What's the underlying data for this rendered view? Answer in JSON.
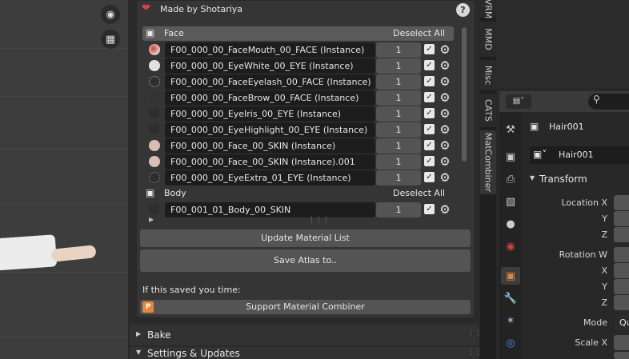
{
  "panel": {
    "made_by": "Made by Shotariya",
    "help": "?",
    "groups": [
      {
        "name": "Face",
        "deselect": "Deselect All"
      },
      {
        "name": "Body",
        "deselect": "Deselect All"
      }
    ],
    "materials": [
      {
        "name": "F00_000_00_FaceMouth_00_FACE (Instance)",
        "value": "1"
      },
      {
        "name": "F00_000_00_EyeWhite_00_EYE (Instance)",
        "value": "1"
      },
      {
        "name": "F00_000_00_FaceEyelash_00_FACE (Instance)",
        "value": "1"
      },
      {
        "name": "F00_000_00_FaceBrow_00_FACE (Instance)",
        "value": "1"
      },
      {
        "name": "F00_000_00_EyeIris_00_EYE (Instance)",
        "value": "1"
      },
      {
        "name": "F00_000_00_EyeHighlight_00_EYE (Instance)",
        "value": "1"
      },
      {
        "name": "F00_000_00_Face_00_SKIN (Instance)",
        "value": "1"
      },
      {
        "name": "F00_000_00_Face_00_SKIN (Instance).001",
        "value": "1"
      },
      {
        "name": "F00_000_00_EyeExtra_01_EYE (Instance)",
        "value": "1"
      },
      {
        "name": "F00_001_01_Body_00_SKIN",
        "value": "1"
      }
    ],
    "update_list": "Update Material List",
    "save_atlas": "Save Atlas to..",
    "saved_time": "If this saved you time:",
    "support": "Support Material Combiner",
    "bake": "Bake",
    "settings": "Settings & Updates"
  },
  "tabs": [
    "VRM",
    "MMD",
    "Misc",
    "CATS",
    "MatCombiner"
  ],
  "properties": {
    "object_name": "Hair001",
    "data_name": "Hair001",
    "transform": "Transform",
    "location_x": "Location X",
    "y": "Y",
    "z": "Z",
    "rotation_w": "Rotation W",
    "x": "X",
    "mode": "Mode",
    "mode_value": "Qu",
    "scale_x": "Scale X"
  },
  "colors": {
    "accent": "#e4873c",
    "heart": "#e04040",
    "panel": "#353535"
  }
}
